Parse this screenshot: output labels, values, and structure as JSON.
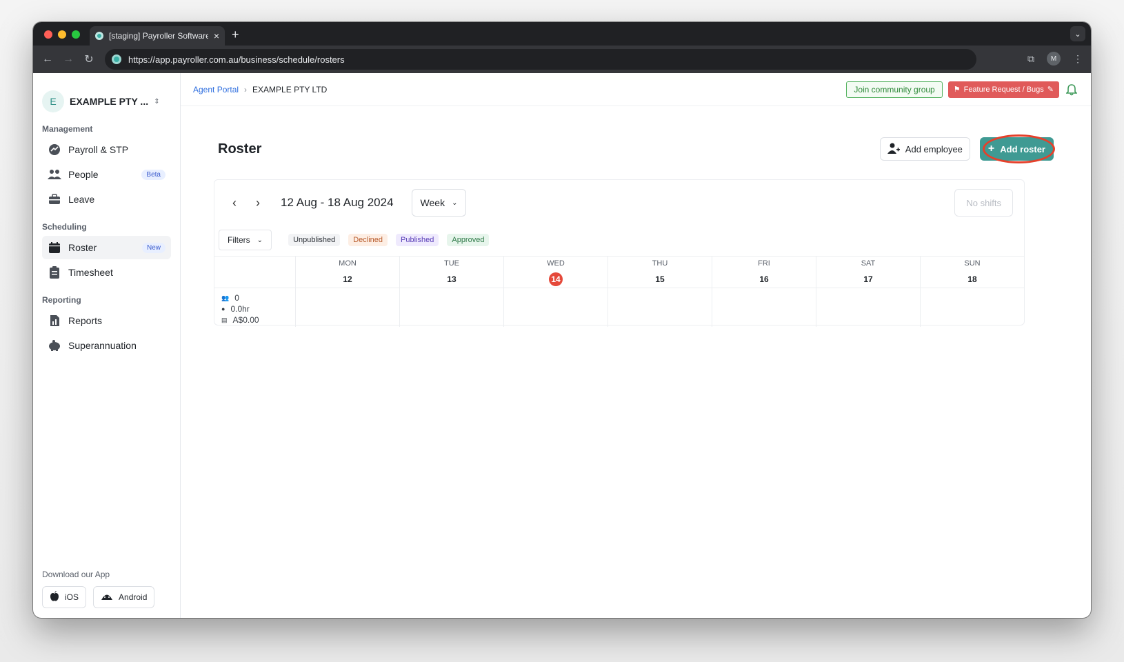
{
  "browser": {
    "tab_title": "[staging] Payroller Software V",
    "url": "https://app.payroller.com.au/business/schedule/rosters",
    "profile_initial": "M"
  },
  "sidebar": {
    "org_initial": "E",
    "org_name": "EXAMPLE PTY ...",
    "sections": {
      "management": "Management",
      "scheduling": "Scheduling",
      "reporting": "Reporting"
    },
    "items": {
      "payroll": "Payroll & STP",
      "people": "People",
      "people_badge": "Beta",
      "leave": "Leave",
      "roster": "Roster",
      "roster_badge": "New",
      "timesheet": "Timesheet",
      "reports": "Reports",
      "super": "Superannuation"
    },
    "download_title": "Download our App",
    "ios": "iOS",
    "android": "Android"
  },
  "topbar": {
    "breadcrumb_link": "Agent Portal",
    "breadcrumb_current": "EXAMPLE PTY LTD",
    "community": "Join community group",
    "feature": "Feature Request / Bugs"
  },
  "roster": {
    "title": "Roster",
    "add_employee": "Add employee",
    "add_roster": "Add roster",
    "range": "12 Aug - 18 Aug 2024",
    "view": "Week",
    "no_shifts": "No shifts",
    "filters": "Filters",
    "statuses": [
      "Unpublished",
      "Declined",
      "Published",
      "Approved"
    ],
    "days": [
      {
        "name": "MON",
        "num": "12"
      },
      {
        "name": "TUE",
        "num": "13"
      },
      {
        "name": "WED",
        "num": "14"
      },
      {
        "name": "THU",
        "num": "15"
      },
      {
        "name": "FRI",
        "num": "16"
      },
      {
        "name": "SAT",
        "num": "17"
      },
      {
        "name": "SUN",
        "num": "18"
      }
    ],
    "summary": {
      "people": "0",
      "hours": "0.0hr",
      "cost": "A$0.00"
    }
  },
  "colors": {
    "accent": "#3f9a93",
    "today": "#e5493a",
    "feature": "#e05a5a",
    "community": "#52b15d"
  }
}
